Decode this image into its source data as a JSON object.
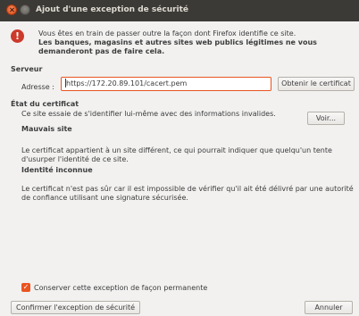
{
  "window": {
    "title": "Ajout d'une exception de sécurité"
  },
  "intro": {
    "line": "Vous êtes en train de passer outre la façon dont Firefox identifie ce site.",
    "warning": "Les banques, magasins et autres sites web publics légitimes ne vous demanderont pas de faire cela."
  },
  "server": {
    "heading": "Serveur",
    "address_label": "Adresse :",
    "address_value": "https://172.20.89.101/cacert.pem",
    "get_cert_button": "Obtenir le certificat"
  },
  "cert_status": {
    "heading": "État du certificat",
    "description": "Ce site essaie de s'identifier lui-même avec des informations invalides.",
    "view_button": "Voir...",
    "wrong_site_heading": "Mauvais site",
    "wrong_site_text": "Le certificat appartient à un site différent, ce qui pourrait indiquer que quelqu'un tente d'usurper l'identité de ce site.",
    "unknown_identity_heading": "Identité inconnue",
    "unknown_identity_text": "Le certificat n'est pas sûr car il est impossible de vérifier qu'il ait été délivré par une autorité de confiance utilisant une signature sécurisée."
  },
  "permanent_checkbox": {
    "label": "Conserver cette exception de façon permanente",
    "checked": true
  },
  "footer": {
    "confirm_button": "Confirmer l'exception de sécurité",
    "cancel_button": "Annuler"
  },
  "colors": {
    "titlebar": "#3b3a36",
    "accent": "#e95420",
    "warning_icon": "#cc3a2a"
  }
}
